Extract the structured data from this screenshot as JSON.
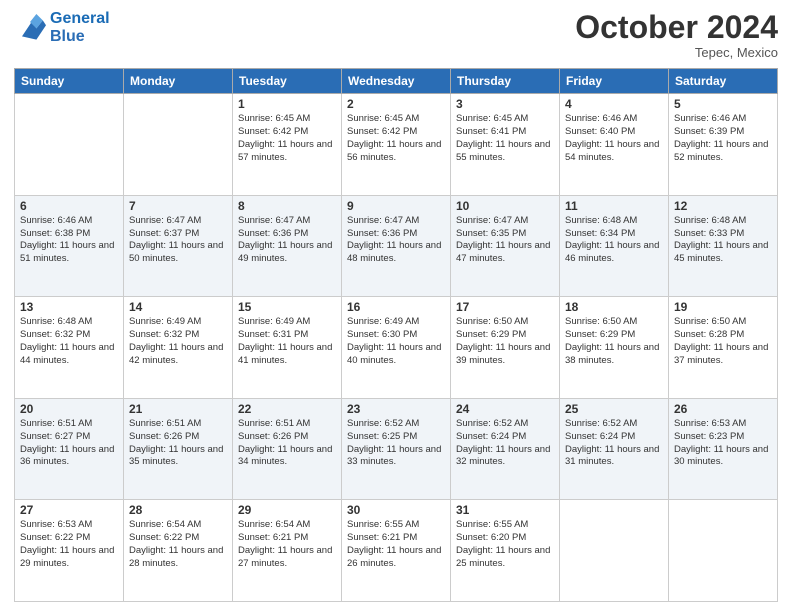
{
  "header": {
    "logo_line1": "General",
    "logo_line2": "Blue",
    "month": "October 2024",
    "location": "Tepec, Mexico"
  },
  "days_of_week": [
    "Sunday",
    "Monday",
    "Tuesday",
    "Wednesday",
    "Thursday",
    "Friday",
    "Saturday"
  ],
  "weeks": [
    [
      {
        "day": "",
        "info": ""
      },
      {
        "day": "",
        "info": ""
      },
      {
        "day": "1",
        "info": "Sunrise: 6:45 AM\nSunset: 6:42 PM\nDaylight: 11 hours and 57 minutes."
      },
      {
        "day": "2",
        "info": "Sunrise: 6:45 AM\nSunset: 6:42 PM\nDaylight: 11 hours and 56 minutes."
      },
      {
        "day": "3",
        "info": "Sunrise: 6:45 AM\nSunset: 6:41 PM\nDaylight: 11 hours and 55 minutes."
      },
      {
        "day": "4",
        "info": "Sunrise: 6:46 AM\nSunset: 6:40 PM\nDaylight: 11 hours and 54 minutes."
      },
      {
        "day": "5",
        "info": "Sunrise: 6:46 AM\nSunset: 6:39 PM\nDaylight: 11 hours and 52 minutes."
      }
    ],
    [
      {
        "day": "6",
        "info": "Sunrise: 6:46 AM\nSunset: 6:38 PM\nDaylight: 11 hours and 51 minutes."
      },
      {
        "day": "7",
        "info": "Sunrise: 6:47 AM\nSunset: 6:37 PM\nDaylight: 11 hours and 50 minutes."
      },
      {
        "day": "8",
        "info": "Sunrise: 6:47 AM\nSunset: 6:36 PM\nDaylight: 11 hours and 49 minutes."
      },
      {
        "day": "9",
        "info": "Sunrise: 6:47 AM\nSunset: 6:36 PM\nDaylight: 11 hours and 48 minutes."
      },
      {
        "day": "10",
        "info": "Sunrise: 6:47 AM\nSunset: 6:35 PM\nDaylight: 11 hours and 47 minutes."
      },
      {
        "day": "11",
        "info": "Sunrise: 6:48 AM\nSunset: 6:34 PM\nDaylight: 11 hours and 46 minutes."
      },
      {
        "day": "12",
        "info": "Sunrise: 6:48 AM\nSunset: 6:33 PM\nDaylight: 11 hours and 45 minutes."
      }
    ],
    [
      {
        "day": "13",
        "info": "Sunrise: 6:48 AM\nSunset: 6:32 PM\nDaylight: 11 hours and 44 minutes."
      },
      {
        "day": "14",
        "info": "Sunrise: 6:49 AM\nSunset: 6:32 PM\nDaylight: 11 hours and 42 minutes."
      },
      {
        "day": "15",
        "info": "Sunrise: 6:49 AM\nSunset: 6:31 PM\nDaylight: 11 hours and 41 minutes."
      },
      {
        "day": "16",
        "info": "Sunrise: 6:49 AM\nSunset: 6:30 PM\nDaylight: 11 hours and 40 minutes."
      },
      {
        "day": "17",
        "info": "Sunrise: 6:50 AM\nSunset: 6:29 PM\nDaylight: 11 hours and 39 minutes."
      },
      {
        "day": "18",
        "info": "Sunrise: 6:50 AM\nSunset: 6:29 PM\nDaylight: 11 hours and 38 minutes."
      },
      {
        "day": "19",
        "info": "Sunrise: 6:50 AM\nSunset: 6:28 PM\nDaylight: 11 hours and 37 minutes."
      }
    ],
    [
      {
        "day": "20",
        "info": "Sunrise: 6:51 AM\nSunset: 6:27 PM\nDaylight: 11 hours and 36 minutes."
      },
      {
        "day": "21",
        "info": "Sunrise: 6:51 AM\nSunset: 6:26 PM\nDaylight: 11 hours and 35 minutes."
      },
      {
        "day": "22",
        "info": "Sunrise: 6:51 AM\nSunset: 6:26 PM\nDaylight: 11 hours and 34 minutes."
      },
      {
        "day": "23",
        "info": "Sunrise: 6:52 AM\nSunset: 6:25 PM\nDaylight: 11 hours and 33 minutes."
      },
      {
        "day": "24",
        "info": "Sunrise: 6:52 AM\nSunset: 6:24 PM\nDaylight: 11 hours and 32 minutes."
      },
      {
        "day": "25",
        "info": "Sunrise: 6:52 AM\nSunset: 6:24 PM\nDaylight: 11 hours and 31 minutes."
      },
      {
        "day": "26",
        "info": "Sunrise: 6:53 AM\nSunset: 6:23 PM\nDaylight: 11 hours and 30 minutes."
      }
    ],
    [
      {
        "day": "27",
        "info": "Sunrise: 6:53 AM\nSunset: 6:22 PM\nDaylight: 11 hours and 29 minutes."
      },
      {
        "day": "28",
        "info": "Sunrise: 6:54 AM\nSunset: 6:22 PM\nDaylight: 11 hours and 28 minutes."
      },
      {
        "day": "29",
        "info": "Sunrise: 6:54 AM\nSunset: 6:21 PM\nDaylight: 11 hours and 27 minutes."
      },
      {
        "day": "30",
        "info": "Sunrise: 6:55 AM\nSunset: 6:21 PM\nDaylight: 11 hours and 26 minutes."
      },
      {
        "day": "31",
        "info": "Sunrise: 6:55 AM\nSunset: 6:20 PM\nDaylight: 11 hours and 25 minutes."
      },
      {
        "day": "",
        "info": ""
      },
      {
        "day": "",
        "info": ""
      }
    ]
  ]
}
